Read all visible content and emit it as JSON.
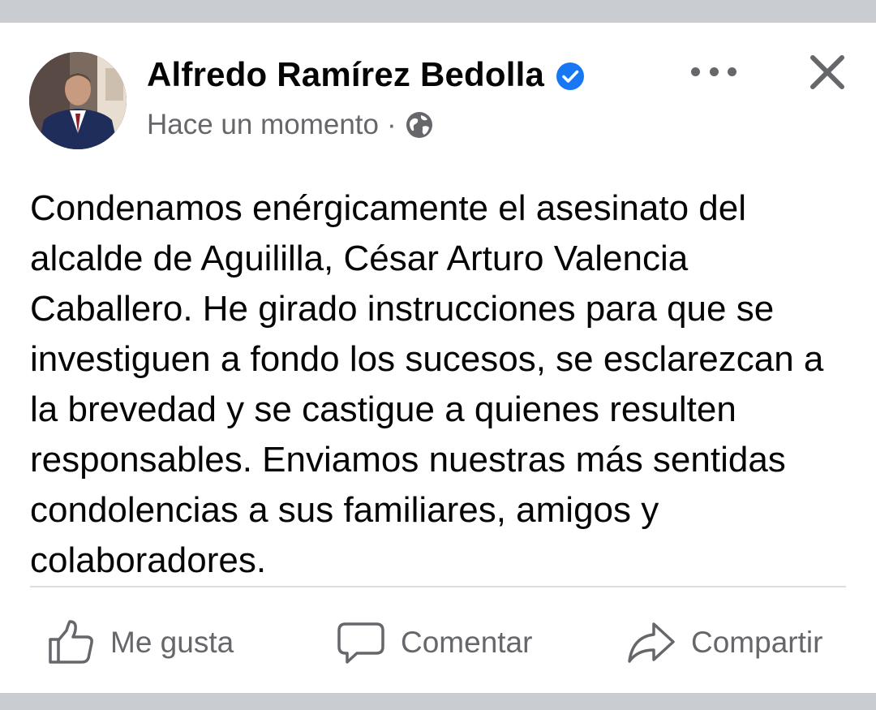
{
  "post": {
    "author": "Alfredo Ramírez Bedolla",
    "timestamp": "Hace un momento",
    "separator": "·",
    "privacy_icon": "globe-icon",
    "verified_icon": "verified-badge-icon",
    "text": "Condenamos enérgicamente el asesinato del alcalde de Aguililla, César Arturo Valencia Caballero. He girado instrucciones para que se investiguen a fondo los sucesos, se esclarezcan a la brevedad y se castigue a quienes resulten responsables. Enviamos nuestras más sentidas condolencias a sus familiares, amigos y colaboradores."
  },
  "actions": {
    "like_label": "Me gusta",
    "comment_label": "Comentar",
    "share_label": "Compartir"
  },
  "colors": {
    "verified": "#1877f2",
    "text_primary": "#050505",
    "text_secondary": "#65676b",
    "background": "#c9ccd1"
  }
}
